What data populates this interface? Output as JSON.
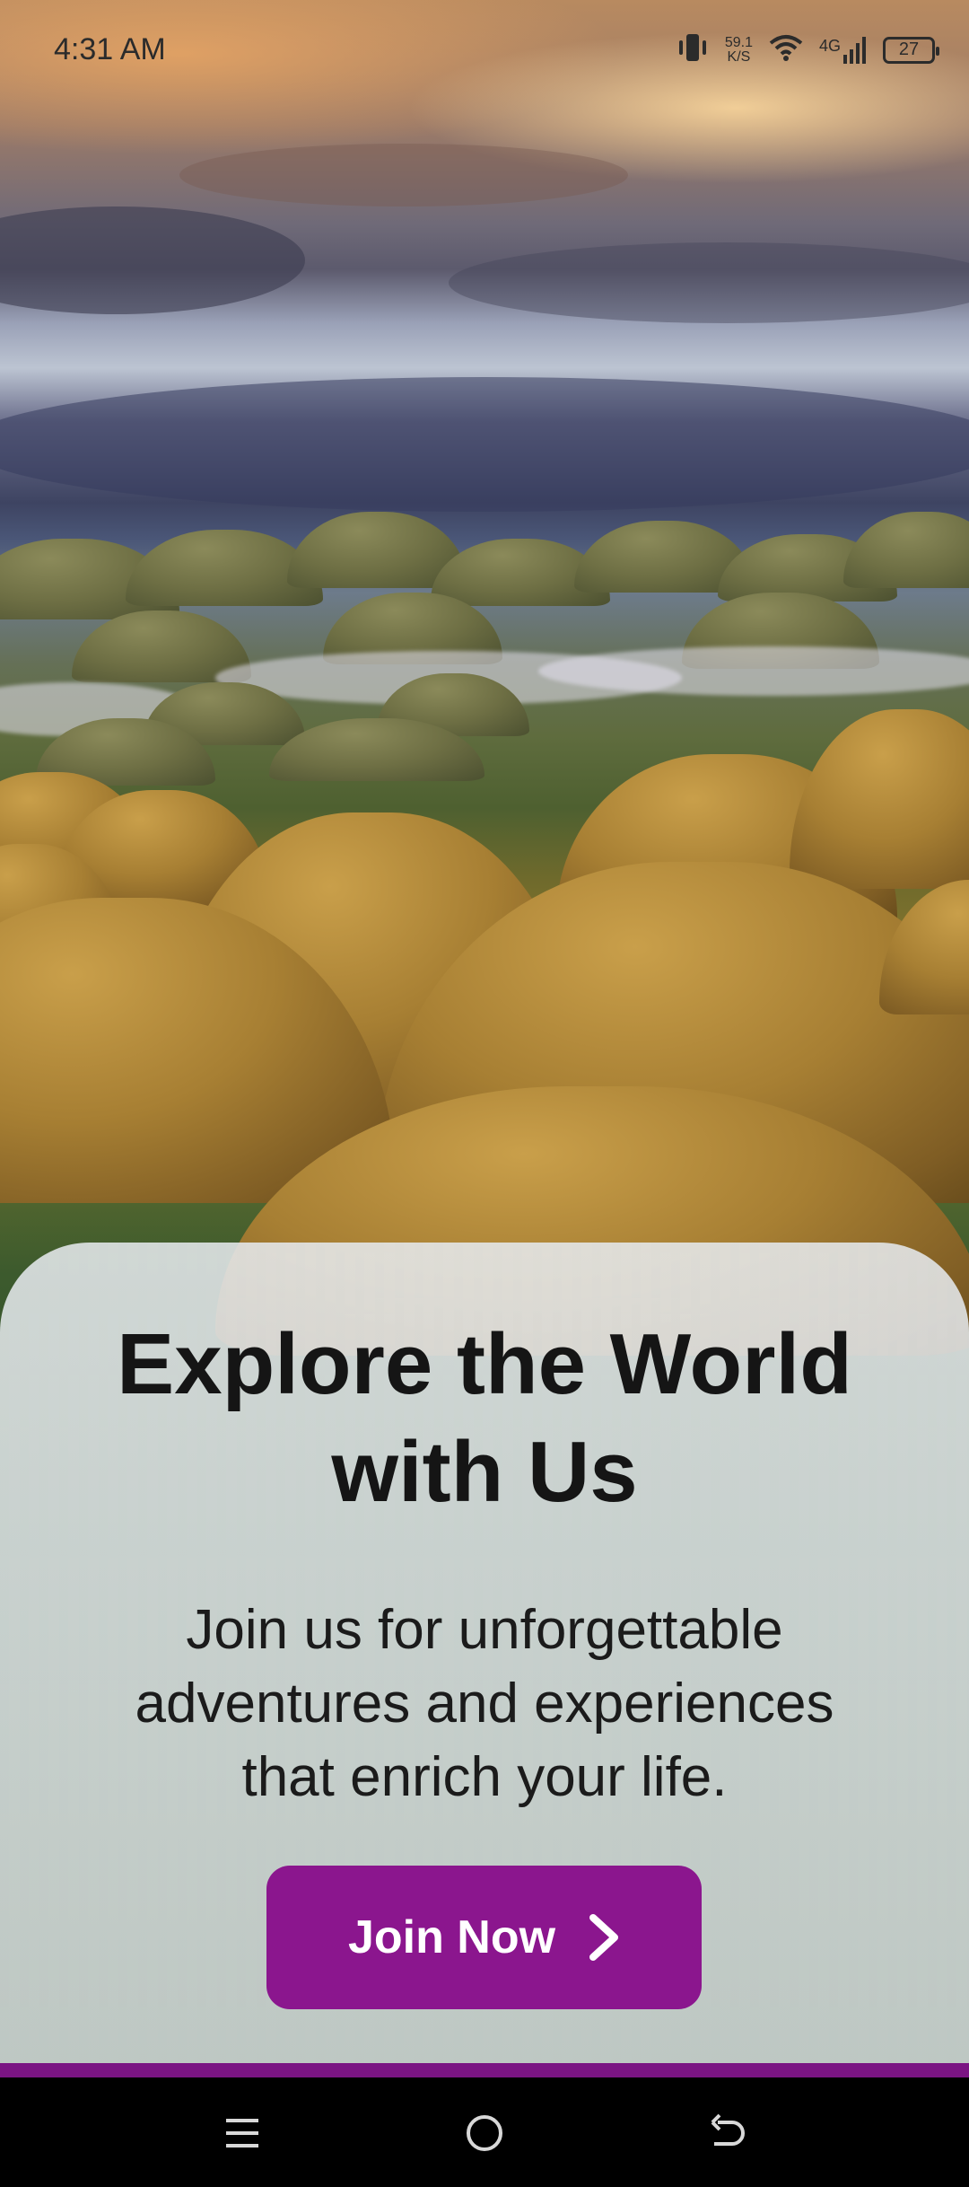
{
  "status_bar": {
    "time": "4:31 AM",
    "net_speed_value": "59.1",
    "net_speed_unit": "K/S",
    "network_type": "4G",
    "battery": "27"
  },
  "hero": {
    "title": "Explore the World with Us",
    "subtitle": "Join us for unforgettable adventures and experiences that enrich your life.",
    "button_label": "Join Now",
    "accent_color": "#8b168e"
  },
  "nav_bar": {
    "icons": [
      "menu-icon",
      "home-icon",
      "back-icon"
    ]
  }
}
